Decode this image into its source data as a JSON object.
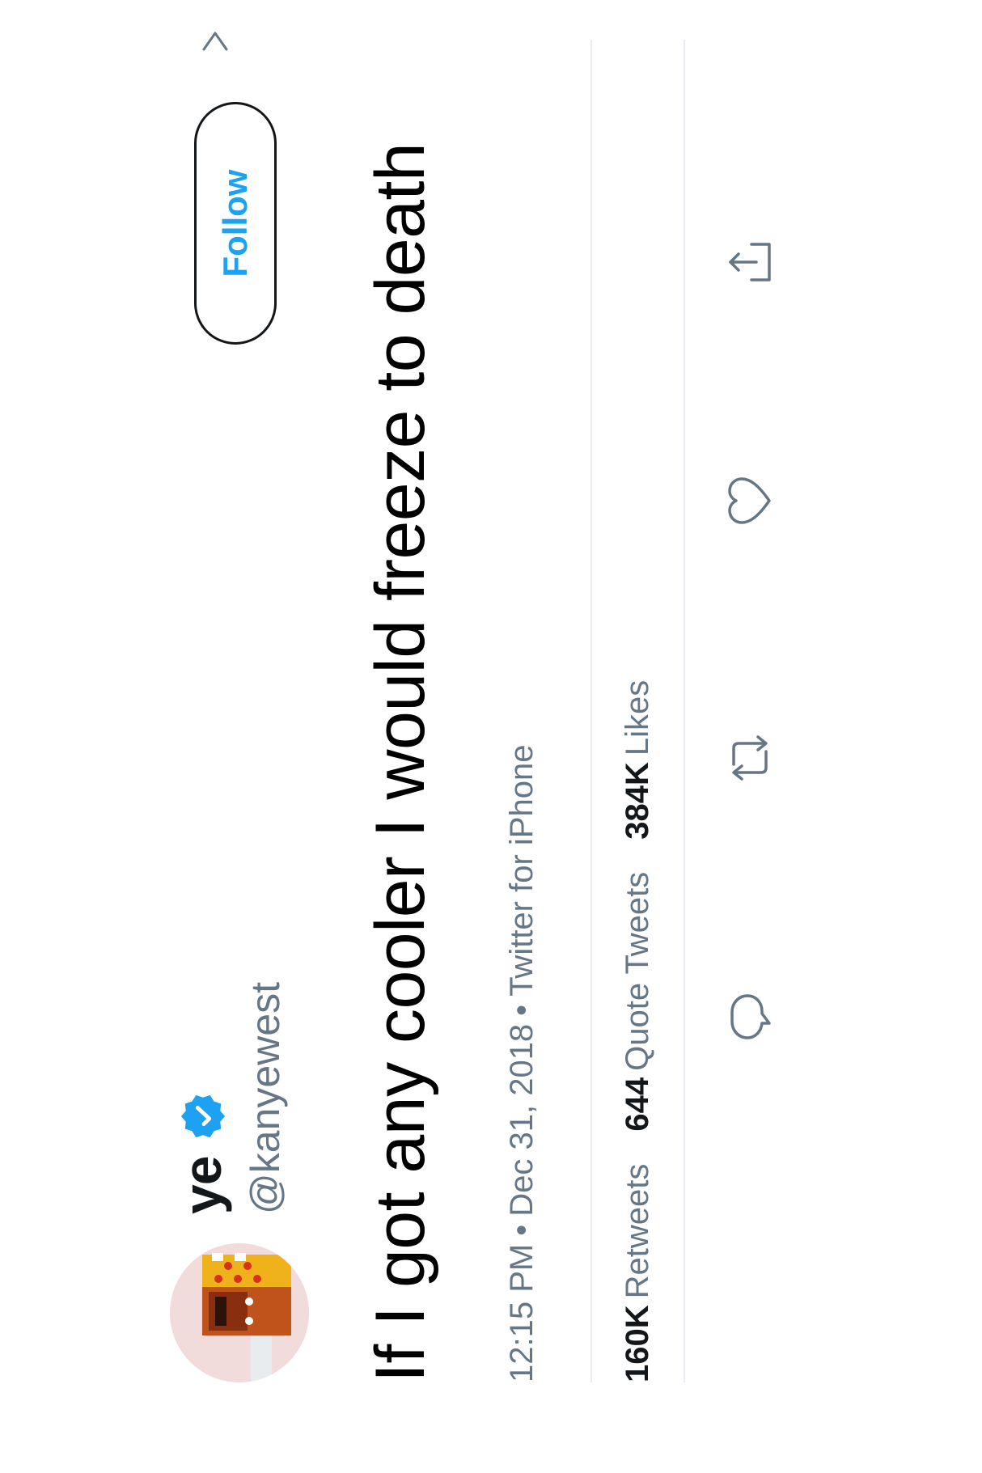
{
  "user": {
    "display_name": "ye",
    "handle": "@kanyewest",
    "verified": true,
    "avatar_icon": "profile-photo-icon",
    "verified_icon": "verified-badge-icon"
  },
  "header": {
    "follow_label": "Follow",
    "more_icon": "chevron-right-icon"
  },
  "tweet": {
    "text": "If I got any cooler I would freeze to death",
    "time": "12:15 PM",
    "date": "Dec 31, 2018",
    "source": "Twitter for iPhone",
    "separator": "•"
  },
  "stats": {
    "retweets": {
      "count": "160K",
      "label": "Retweets"
    },
    "quotes": {
      "count": "644",
      "label": "Quote Tweets"
    },
    "likes": {
      "count": "384K",
      "label": "Likes"
    }
  },
  "actions": [
    {
      "icon": "reply-icon"
    },
    {
      "icon": "retweet-icon"
    },
    {
      "icon": "like-icon"
    },
    {
      "icon": "share-icon"
    }
  ],
  "colors": {
    "accent": "#1da1f2",
    "text": "#14171a",
    "muted": "#657786",
    "divider": "#e6ecf0"
  }
}
